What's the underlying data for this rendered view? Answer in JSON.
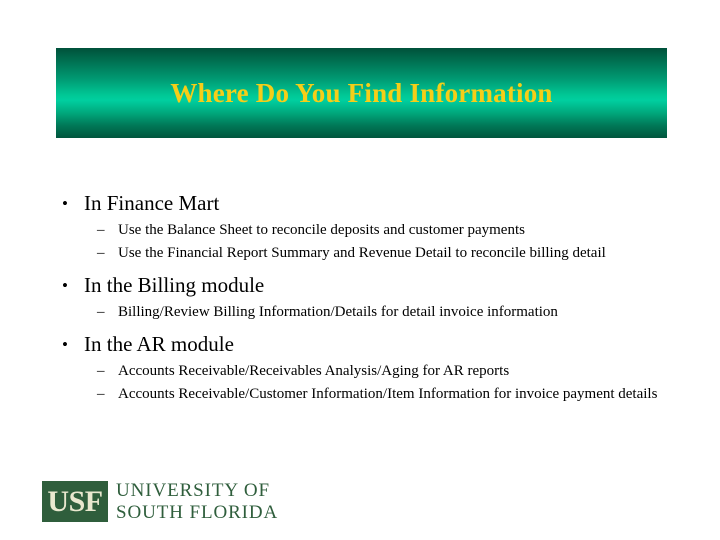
{
  "slide": {
    "title": "Where Do You Find Information",
    "background_color": "#ffffff",
    "title_color": "#f5ce18",
    "banner_gradient_dark": "#00513a",
    "banner_gradient_light": "#00cfa0",
    "bullet_glyph": "•",
    "sub_bullet_glyph": "–",
    "groups": [
      {
        "heading": "In Finance Mart",
        "items": [
          "Use the Balance Sheet to reconcile deposits and customer payments",
          "Use the Financial Report Summary and Revenue Detail to reconcile billing detail"
        ]
      },
      {
        "heading": "In the Billing module",
        "items": [
          "Billing/Review Billing Information/Details for  detail invoice information"
        ]
      },
      {
        "heading": "In the AR module",
        "items": [
          "Accounts Receivable/Receivables Analysis/Aging for AR reports",
          "Accounts Receivable/Customer Information/Item Information for invoice payment details"
        ]
      }
    ]
  },
  "logo": {
    "mark": "USF",
    "line1": "UNIVERSITY OF",
    "line2": "SOUTH FLORIDA",
    "box_color": "#2f5e3c",
    "mark_color": "#e9e8cf",
    "rule_color": "#cfc9a2"
  }
}
